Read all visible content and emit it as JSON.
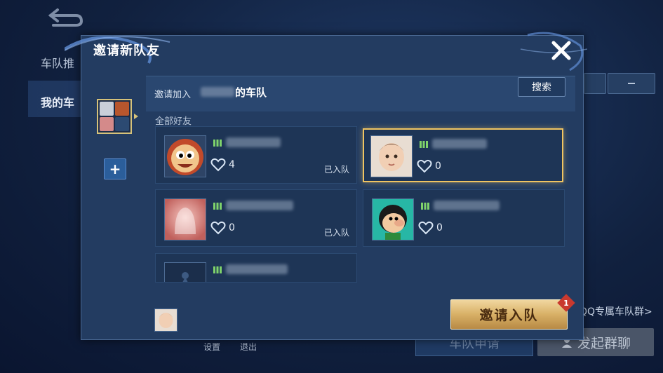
{
  "background": {
    "tabs": [
      {
        "label": "车队推"
      },
      {
        "label": "我的车"
      }
    ],
    "qq_link": "QQ专属车队群>",
    "bottom_links": [
      "设置",
      "退出"
    ],
    "team_apply_label": "车队申请",
    "launch_group_label": "发起群聊"
  },
  "modal": {
    "title": "邀请新队友",
    "invite_prefix": "邀请加入",
    "team_suffix": "的车队",
    "search_label": "搜索",
    "all_friends_label": "全部好友",
    "add_label": "+",
    "invite_button_label": "邀请入队",
    "invite_badge_count": "1"
  },
  "friends": [
    {
      "heart_count": "4",
      "status": "已入队",
      "avatar": "monkey",
      "selected": false
    },
    {
      "heart_count": "0",
      "status": "",
      "avatar": "baby",
      "selected": true
    },
    {
      "heart_count": "0",
      "status": "已入队",
      "avatar": "ghost",
      "selected": false
    },
    {
      "heart_count": "0",
      "status": "",
      "avatar": "cartoon-boy",
      "selected": false
    },
    {
      "heart_count": "",
      "status": "",
      "avatar": "default-emblem",
      "selected": false
    }
  ],
  "colors": {
    "accent_gold": "#f0c461",
    "modal_bg": "#233c61",
    "badge_red": "#c9392e"
  }
}
